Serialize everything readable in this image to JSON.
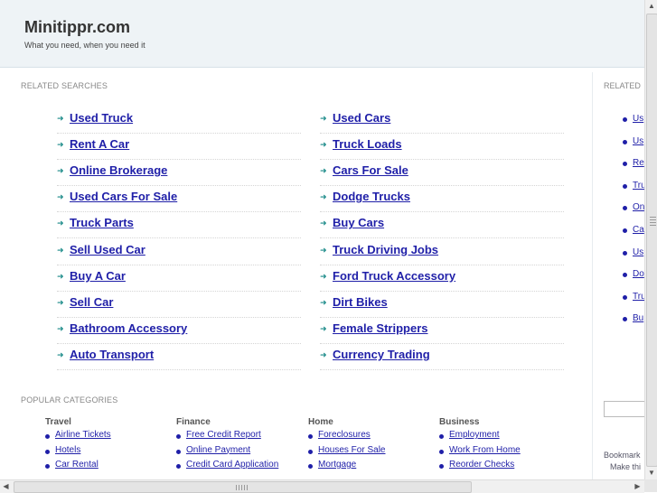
{
  "header": {
    "title": "Minitippr.com",
    "tagline": "What you need, when you need it"
  },
  "related": {
    "label": "RELATED SEARCHES",
    "left": [
      "Used Truck",
      "Rent A Car",
      "Online Brokerage",
      "Used Cars For Sale",
      "Truck Parts",
      "Sell Used Car",
      "Buy A Car",
      "Sell Car",
      "Bathroom Accessory",
      "Auto Transport"
    ],
    "right": [
      "Used Cars",
      "Truck Loads",
      "Cars For Sale",
      "Dodge Trucks",
      "Buy Cars",
      "Truck Driving Jobs",
      "Ford Truck Accessory",
      "Dirt Bikes",
      "Female Strippers",
      "Currency Trading"
    ]
  },
  "popular": {
    "label": "POPULAR CATEGORIES",
    "categories": [
      {
        "name": "Travel",
        "items": [
          "Airline Tickets",
          "Hotels",
          "Car Rental"
        ]
      },
      {
        "name": "Finance",
        "items": [
          "Free Credit Report",
          "Online Payment",
          "Credit Card Application"
        ]
      },
      {
        "name": "Home",
        "items": [
          "Foreclosures",
          "Houses For Sale",
          "Mortgage"
        ]
      },
      {
        "name": "Business",
        "items": [
          "Employment",
          "Work From Home",
          "Reorder Checks"
        ]
      }
    ]
  },
  "sidebar": {
    "label": "RELATED",
    "items": [
      "Us",
      "Us",
      "Re",
      "Tru",
      "On",
      "Ca",
      "Us",
      "Do",
      "Tru",
      "Bu"
    ],
    "bookmark": "Bookmark",
    "make": "Make thi"
  },
  "colors": {
    "link": "#1f1fa8",
    "arrow": "#1a8a88",
    "header_bg": "#eef3f6"
  }
}
